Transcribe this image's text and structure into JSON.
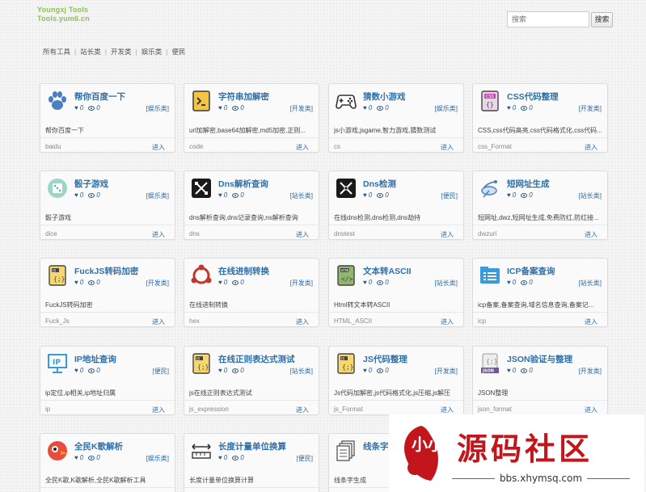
{
  "header": {
    "logo_line1": "Youngxj Tools",
    "logo_line2": "Tools.yum6.cn",
    "search_placeholder": "搜索",
    "search_button": "搜索"
  },
  "breadcrumb": [
    "所有工具",
    "站长类",
    "开发类",
    "娱乐类",
    "便民"
  ],
  "cards": [
    {
      "title": "帮你百度一下",
      "likes": "0",
      "views": "0",
      "category": "[娱乐类]",
      "desc": "帮你百度一下",
      "slug": "baidu",
      "enter": "进入",
      "icon": "paw-icon"
    },
    {
      "title": "字符串加解密",
      "likes": "0",
      "views": "0",
      "category": "[开发类]",
      "desc": "url加解密,base64加解密,md5加密,正则...",
      "slug": "code",
      "enter": "进入",
      "icon": "terminal-file-icon"
    },
    {
      "title": "猜数小游戏",
      "likes": "0",
      "views": "0",
      "category": "[娱乐类]",
      "desc": "js小游戏,jsgame,智力游戏,猜数测试",
      "slug": "cs",
      "enter": "进入",
      "icon": "gamepad-icon"
    },
    {
      "title": "CSS代码整理",
      "likes": "0",
      "views": "0",
      "category": "[开发类]",
      "desc": "CSS,css代码高亮,css代码格式化,css代码...",
      "slug": "css_Format",
      "enter": "进入",
      "icon": "css-file-icon"
    },
    {
      "title": "骰子游戏",
      "likes": "0",
      "views": "0",
      "category": "[娱乐类]",
      "desc": "骰子游戏",
      "slug": "dice",
      "enter": "进入",
      "icon": "dice-icon"
    },
    {
      "title": "Dns解析查询",
      "likes": "0",
      "views": "0",
      "category": "[站长类]",
      "desc": "dns解析查询,dns记录查询,ns解析查询",
      "slug": "dns",
      "enter": "进入",
      "icon": "dns-icon"
    },
    {
      "title": "Dns检测",
      "likes": "0",
      "views": "0",
      "category": "[便民]",
      "desc": "在线dns检测,dns检测,dns劫持",
      "slug": "dnstest",
      "enter": "进入",
      "icon": "dns-check-icon"
    },
    {
      "title": "短网址生成",
      "likes": "0",
      "views": "0",
      "category": "[站长类]",
      "desc": "短网址,dwz,短网址生成,免费防红,防红接...",
      "slug": "dwzurl",
      "enter": "进入",
      "icon": "satellite-icon"
    },
    {
      "title": "FuckJS转码加密",
      "likes": "0",
      "views": "0",
      "category": "[开发类]",
      "desc": "FuckJS转码加密",
      "slug": "Fuck_Js",
      "enter": "进入",
      "icon": "js-file-icon"
    },
    {
      "title": "在线进制转换",
      "likes": "0",
      "views": "0",
      "category": "[开发类]",
      "desc": "在线进制转换",
      "slug": "hex",
      "enter": "进入",
      "icon": "hex-convert-icon"
    },
    {
      "title": "文本转ASCII",
      "likes": "0",
      "views": "0",
      "category": "[站长类]",
      "desc": "Html转文本转ASCII",
      "slug": "HTML_ASCII",
      "enter": "进入",
      "icon": "html-file-icon"
    },
    {
      "title": "ICP备案查询",
      "likes": "0",
      "views": "0",
      "category": "[站长类]",
      "desc": "icp备案,备案查询,域名信息查询,备案记...",
      "slug": "icp",
      "enter": "进入",
      "icon": "folder-list-icon"
    },
    {
      "title": "IP地址查询",
      "likes": "0",
      "views": "0",
      "category": "[便民]",
      "desc": "ip定位,ip相关,ip地址归属",
      "slug": "ip",
      "enter": "进入",
      "icon": "ip-monitor-icon"
    },
    {
      "title": "在线正则表达式测试",
      "likes": "0",
      "views": "0",
      "category": "[站长类]",
      "desc": "js在线正则表达式测试",
      "slug": "js_expression",
      "enter": "进入",
      "icon": "js-file-icon"
    },
    {
      "title": "JS代码整理",
      "likes": "0",
      "views": "0",
      "category": "[开发类]",
      "desc": "Js代码加解密,js代码格式化,js压缩,js解压",
      "slug": "js_Format",
      "enter": "进入",
      "icon": "js-file-icon"
    },
    {
      "title": "JSON验证与整理",
      "likes": "0",
      "views": "0",
      "category": "[开发类]",
      "desc": "JSON整理",
      "slug": "json_format",
      "enter": "进入",
      "icon": "json-file-icon"
    },
    {
      "title": "全民K歌解析",
      "likes": "0",
      "views": "0",
      "category": "[娱乐类]",
      "desc": "全民K歌,K歌解析,全民K歌解析工具",
      "slug": "",
      "enter": "",
      "icon": "karaoke-bird-icon"
    },
    {
      "title": "长度计量单位换算",
      "likes": "0",
      "views": "0",
      "category": "[便民]",
      "desc": "长度计量单位换算计算",
      "slug": "",
      "enter": "",
      "icon": "ruler-icon"
    },
    {
      "title": "线条字生",
      "likes": "",
      "views": "",
      "category": "",
      "desc": "线条字生成",
      "slug": "",
      "enter": "",
      "icon": "stack-pages-icon"
    }
  ],
  "watermark": {
    "title": "源码社区",
    "url": "bbs.xhymsq.com",
    "logo_text": "小小"
  },
  "colors": {
    "title_blue": "#2f6fa8",
    "logo_green": "#8fbf5a",
    "watermark_red": "#c3151c"
  }
}
